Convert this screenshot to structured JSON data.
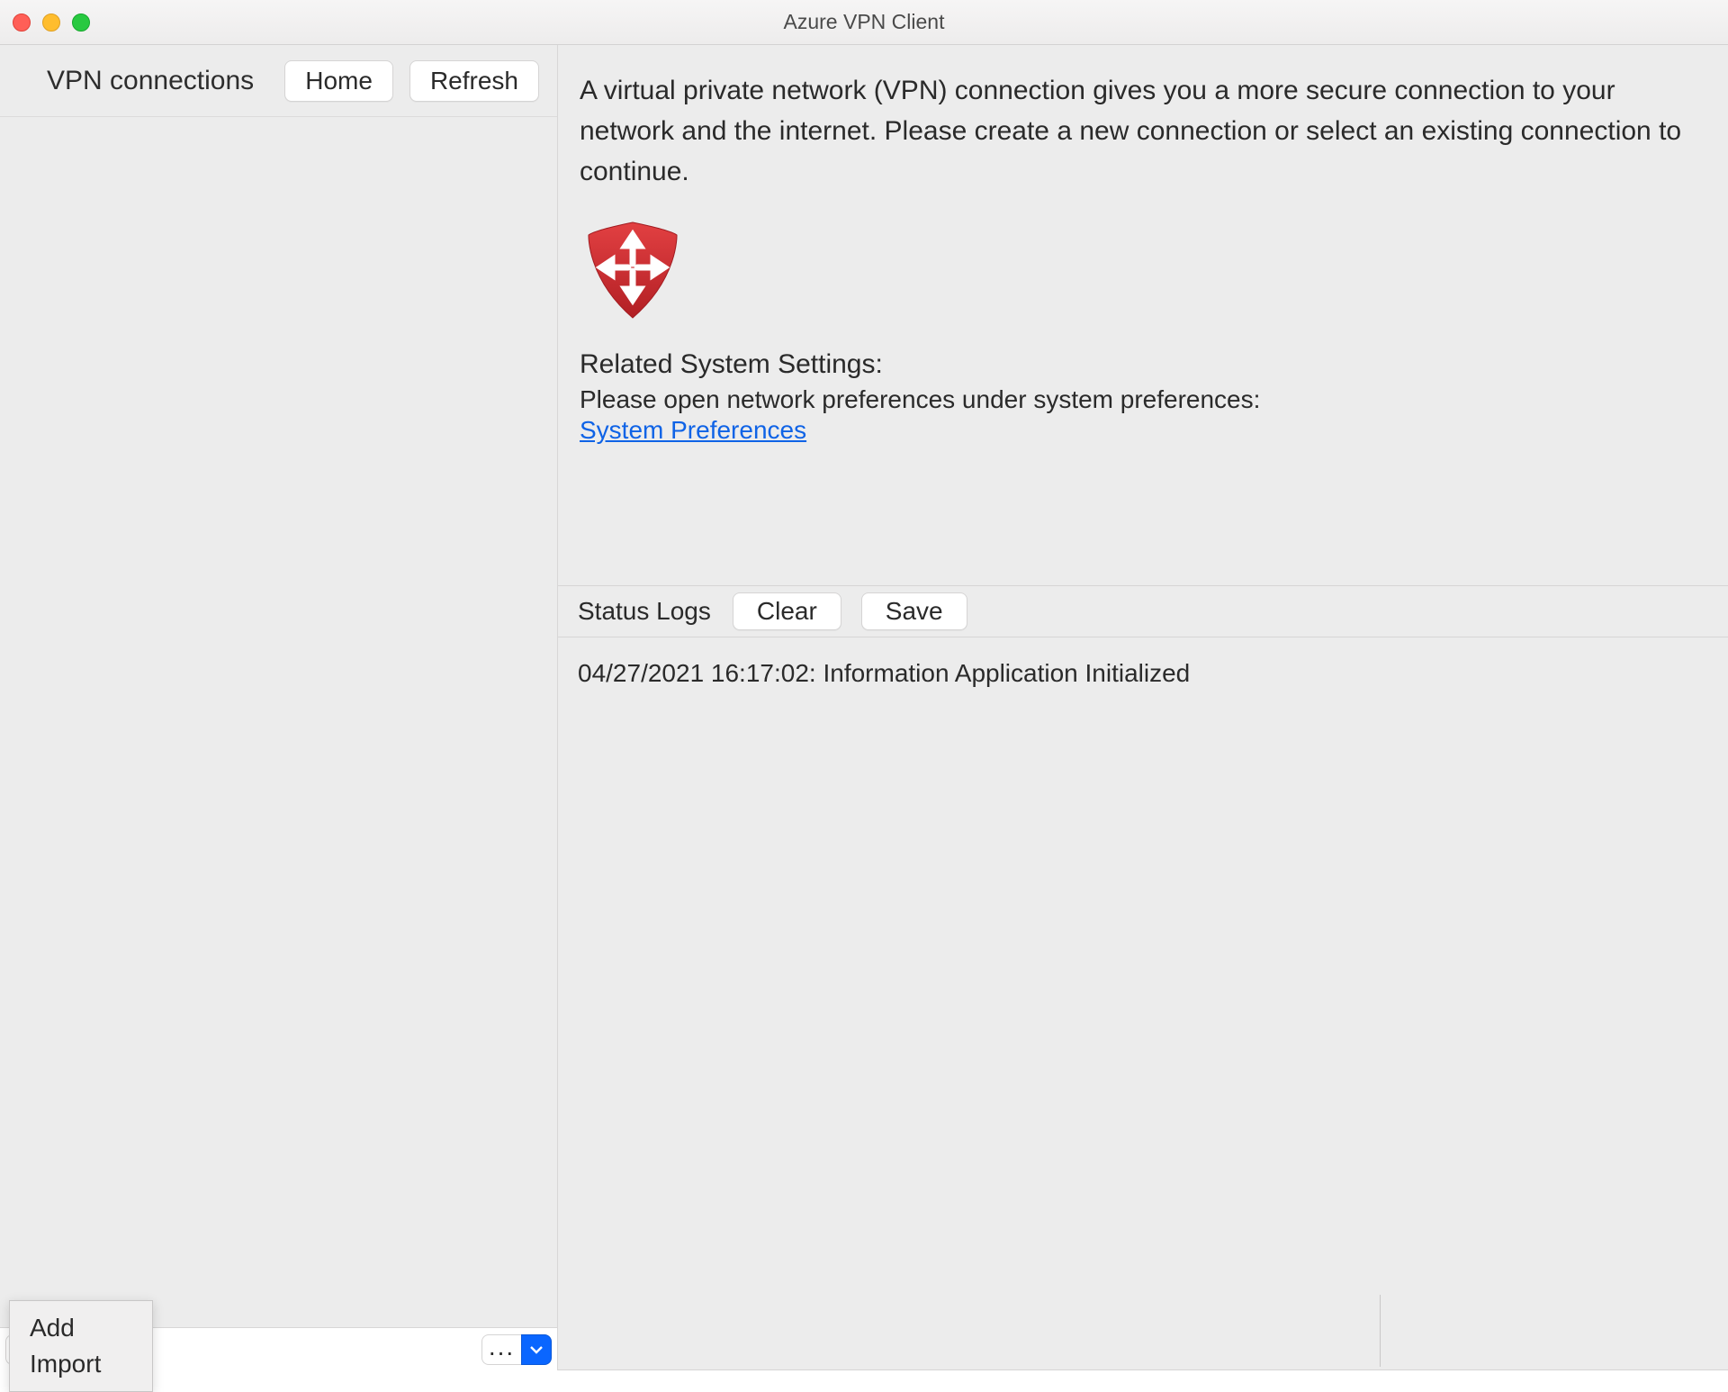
{
  "window": {
    "title": "Azure VPN Client"
  },
  "sidebar": {
    "title": "VPN connections",
    "home_label": "Home",
    "refresh_label": "Refresh",
    "footer": {
      "add_glyph": "+",
      "more_glyph": "..."
    }
  },
  "main": {
    "intro": "A virtual private network (VPN) connection gives you a more secure connection to your network and the internet. Please create a new connection or select an existing connection to continue.",
    "related_heading": "Related System Settings:",
    "related_sub": "Please open network preferences under system preferences:",
    "syspref_link": "System Preferences"
  },
  "status": {
    "label": "Status Logs",
    "clear_label": "Clear",
    "save_label": "Save",
    "log_line": "04/27/2021 16:17:02: Information Application Initialized"
  },
  "popup": {
    "add": "Add",
    "import": "Import"
  }
}
